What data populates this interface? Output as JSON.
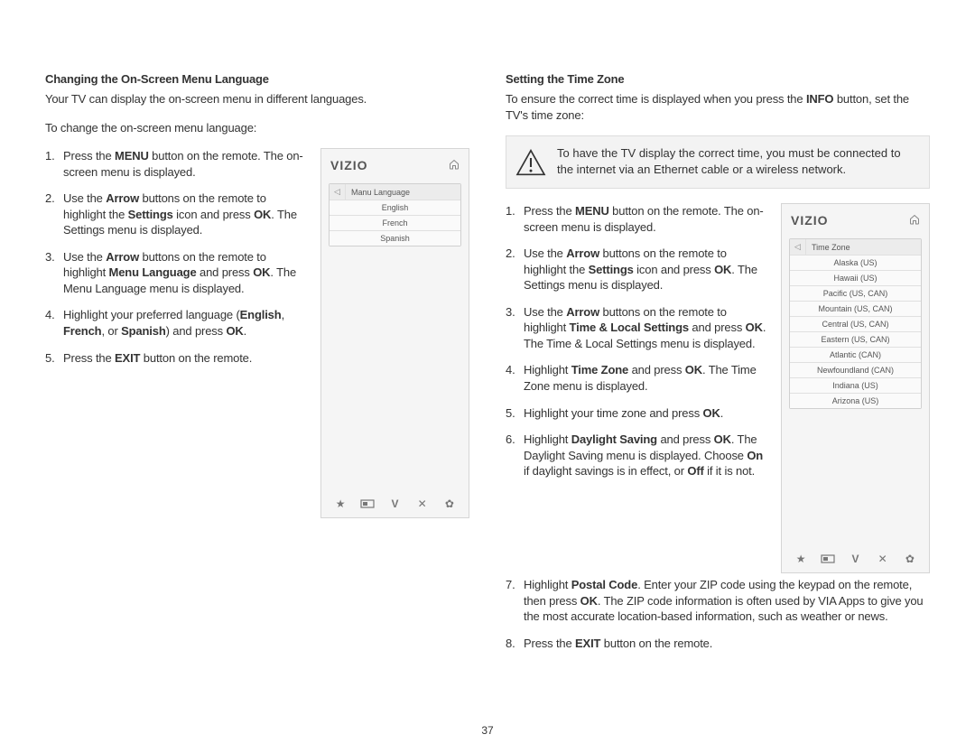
{
  "page_number": "37",
  "left": {
    "heading": "Changing the On-Screen Menu Language",
    "intro1": "Your TV can display the on-screen menu in different languages.",
    "intro2": "To change the on-screen menu language:",
    "steps_html": [
      "Press the <b>MENU</b> button on the remote. The on-screen menu is displayed.",
      "Use the <b>Arrow</b> buttons on the remote to highlight the <b>Settings</b> icon and press <b>OK</b>. The Settings menu is displayed.",
      "Use the <b>Arrow</b> buttons on the remote to highlight <b>Menu Language</b> and press <b>OK</b>. The Menu Language menu is displayed.",
      "Highlight your preferred language (<b>English</b>, <b>French</b>, or <b>Spanish</b>) and press <b>OK</b>.",
      "Press the <b>EXIT</b> button on the remote."
    ],
    "tv": {
      "brand": "VIZIO",
      "list_title": "Manu Language",
      "items": [
        "English",
        "French",
        "Spanish"
      ]
    }
  },
  "right": {
    "heading": "Setting the Time Zone",
    "intro_html": "To ensure the correct time is displayed when you press the <b>INFO</b> button, set the TV's time zone:",
    "warning": "To have the TV display the correct time, you must be connected to the internet via an Ethernet cable or a wireless network.",
    "steps_html": [
      "Press the <b>MENU</b> button on the remote. The on-screen menu is displayed.",
      "Use the <b>Arrow</b> buttons on the remote to highlight the <b>Settings</b> icon and press <b>OK</b>. The Settings menu is displayed.",
      "Use the <b>Arrow</b> buttons on the remote to highlight <b>Time & Local Settings</b> and press <b>OK</b>. The Time & Local Settings menu is displayed.",
      "Highlight <b>Time Zone</b> and press <b>OK</b>. The Time Zone menu is displayed.",
      "Highlight your time zone and press <b>OK</b>.",
      "Highlight <b>Daylight Saving</b> and press <b>OK</b>. The Daylight Saving menu is displayed. Choose <b>On</b> if daylight savings is in effect, or <b>Off</b> if it is not.",
      "Highlight <b>Postal Code</b>. Enter your ZIP code using the keypad on the remote, then press <b>OK</b>. The ZIP code information is often used by VIA Apps to give you the most accurate location-based information, such as weather or news.",
      "Press the <b>EXIT</b> button on the remote."
    ],
    "tv": {
      "brand": "VIZIO",
      "list_title": "Time Zone",
      "items": [
        "Alaska (US)",
        "Hawaii (US)",
        "Pacific (US, CAN)",
        "Mountain (US, CAN)",
        "Central (US, CAN)",
        "Eastern (US, CAN)",
        "Atlantic (CAN)",
        "Newfoundland (CAN)",
        "Indiana (US)",
        "Arizona (US)"
      ]
    }
  },
  "icons": {
    "home": "home-icon",
    "back": "back-arrow-icon",
    "star": "star-icon",
    "rect": "rectangle-icon",
    "v": "v-logo-icon",
    "x": "close-icon",
    "gear": "gear-icon",
    "warn": "warning-icon"
  }
}
